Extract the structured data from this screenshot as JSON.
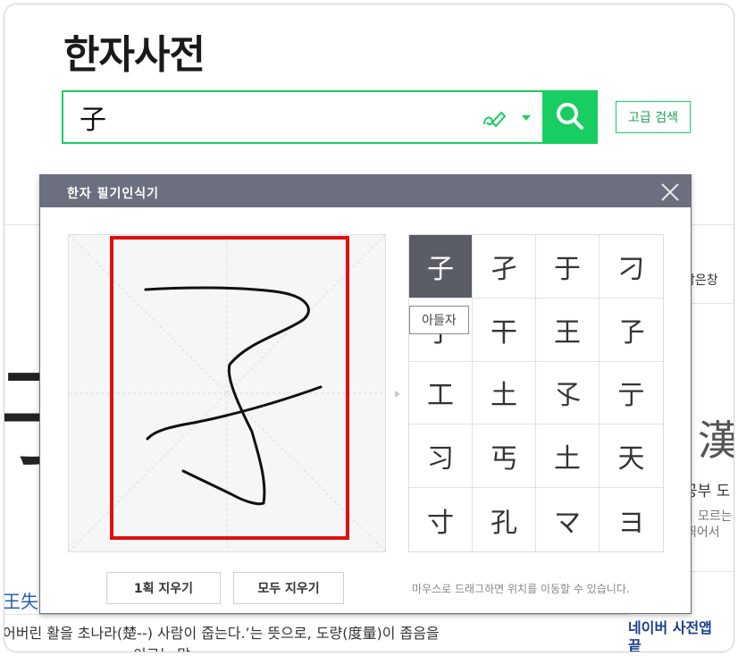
{
  "page": {
    "title": "한자사전"
  },
  "search": {
    "value": "子",
    "advanced_label": "고급 검색",
    "accent": "#19ce60"
  },
  "background": {
    "snippet_window": "밝은창 ",
    "char_left": "子",
    "char_right": "漢",
    "text_study": "공부 도",
    "text_moreun": "모르는",
    "text_jjigeo": "찍어서",
    "link_label": "王失",
    "sentence": "어버린 활을 초나라(楚--) 사람이 줍는다.’는 뜻으로, 도량(度量)이 좁음을",
    "sentence2": "이르는 말",
    "app_title": "네이버 사전앱 ",
    "app_title2": "끝"
  },
  "dialog": {
    "title": "한자 필기인식기",
    "close_icon": "close-icon",
    "candidates": [
      "子",
      "孑",
      "于",
      "刁",
      "子",
      "干",
      "王",
      "孒",
      "工",
      "土",
      "孓",
      "亍",
      "习",
      "丐",
      "土",
      "天",
      "寸",
      "孔",
      "マ",
      "ヨ"
    ],
    "selected_index": 0,
    "tooltip": "아들자",
    "erase_one_label": "1획 지우기",
    "erase_all_label": "모두 지우기",
    "hint": "마우스로 드래그하면 위치를 이동할 수 있습니다."
  }
}
